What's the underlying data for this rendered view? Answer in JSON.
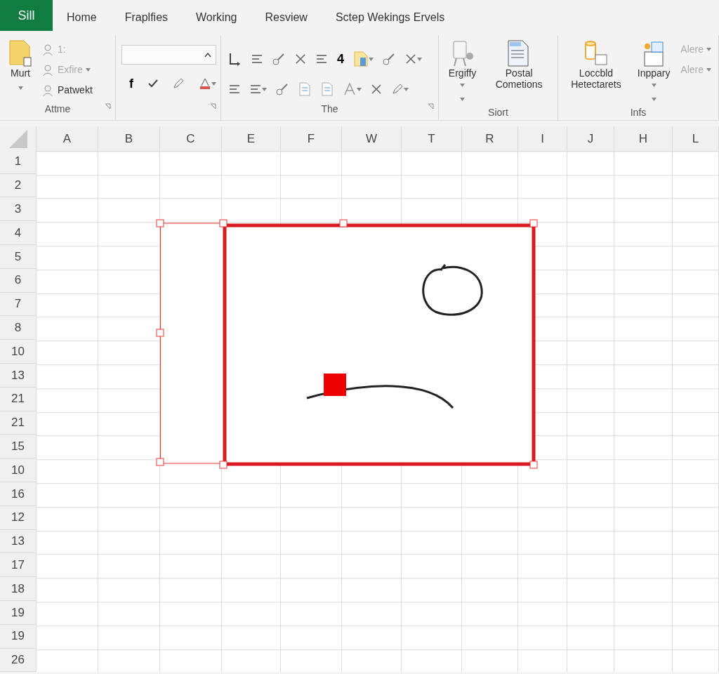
{
  "app_tab": {
    "label": "Sill"
  },
  "tabs": [
    {
      "label": "Home",
      "selected": false
    },
    {
      "label": "Fraplfies",
      "selected": false
    },
    {
      "label": "Working",
      "selected": false
    },
    {
      "label": "Resview",
      "selected": false
    },
    {
      "label": "Sctep Wekings Ervels",
      "selected": false
    }
  ],
  "ribbon": {
    "groups": [
      {
        "label": "Attme",
        "launcher": true,
        "items": [
          {
            "kind": "large",
            "label": "Murt",
            "dropdown": true,
            "disabled": false
          },
          {
            "kind": "small",
            "label": "1:",
            "dropdown": false,
            "disabled": true
          },
          {
            "kind": "small",
            "label": "Exfire",
            "dropdown": true,
            "disabled": true
          },
          {
            "kind": "small",
            "label": "Patwekt",
            "dropdown": false,
            "disabled": false
          }
        ]
      },
      {
        "launcher": true,
        "items": [
          {
            "kind": "field"
          },
          {
            "kind": "glyph",
            "text": "f"
          }
        ]
      },
      {
        "label": "The",
        "launcher": true,
        "items": [
          {
            "kind": "glyph",
            "text": "4"
          }
        ]
      },
      {
        "label": "Siort",
        "launcher": false,
        "items": [
          {
            "kind": "large",
            "label": "Ergiffy",
            "dropdown": true,
            "disabled": false
          },
          {
            "kind": "large",
            "label": "Postal Cometions",
            "dropdown": false,
            "disabled": false
          }
        ]
      },
      {
        "label": "Infs",
        "launcher": false,
        "items": [
          {
            "kind": "large",
            "label": "Loccbld Hetectarets",
            "dropdown": false,
            "disabled": false
          },
          {
            "kind": "large",
            "label": "Inppary",
            "dropdown": true,
            "disabled": false
          },
          {
            "kind": "small",
            "label": "Alere",
            "dropdown": true,
            "disabled": true
          },
          {
            "kind": "small",
            "label": "Alere",
            "dropdown": true,
            "disabled": true
          }
        ]
      }
    ]
  },
  "sheet": {
    "columns": [
      "A",
      "B",
      "C",
      "E",
      "F",
      "W",
      "T",
      "R",
      "I",
      "J",
      "H",
      "L"
    ],
    "rows": [
      "1",
      "2",
      "3",
      "4",
      "5",
      "6",
      "7",
      "8",
      "10",
      "13",
      "21",
      "21",
      "15",
      "10",
      "16",
      "12",
      "13",
      "17",
      "18",
      "19",
      "19",
      "26"
    ],
    "drawing": {
      "selected": true
    }
  }
}
